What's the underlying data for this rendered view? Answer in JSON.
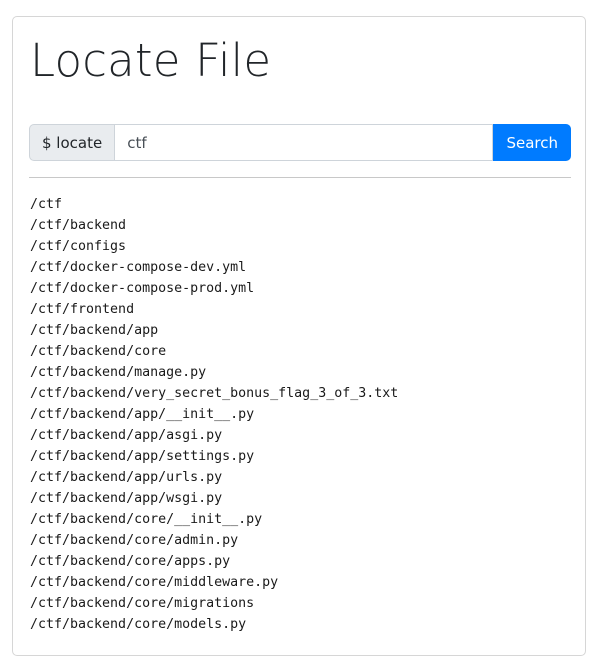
{
  "page": {
    "title": "Locate File"
  },
  "search": {
    "prefix": "$ locate",
    "value": "ctf",
    "button_label": "Search"
  },
  "results": [
    "/ctf",
    "/ctf/backend",
    "/ctf/configs",
    "/ctf/docker-compose-dev.yml",
    "/ctf/docker-compose-prod.yml",
    "/ctf/frontend",
    "/ctf/backend/app",
    "/ctf/backend/core",
    "/ctf/backend/manage.py",
    "/ctf/backend/very_secret_bonus_flag_3_of_3.txt",
    "/ctf/backend/app/__init__.py",
    "/ctf/backend/app/asgi.py",
    "/ctf/backend/app/settings.py",
    "/ctf/backend/app/urls.py",
    "/ctf/backend/app/wsgi.py",
    "/ctf/backend/core/__init__.py",
    "/ctf/backend/core/admin.py",
    "/ctf/backend/core/apps.py",
    "/ctf/backend/core/middleware.py",
    "/ctf/backend/core/migrations",
    "/ctf/backend/core/models.py"
  ],
  "colors": {
    "accent": "#007bff",
    "prepend_bg": "#e9ecef",
    "border": "#ced4da"
  }
}
